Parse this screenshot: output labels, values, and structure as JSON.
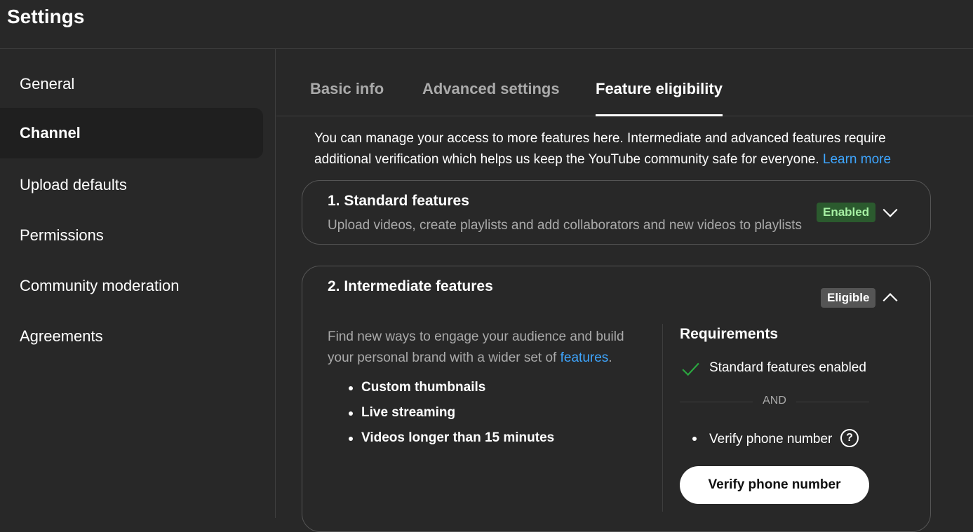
{
  "header": {
    "title": "Settings"
  },
  "sidebar": {
    "items": [
      {
        "label": "General"
      },
      {
        "label": "Channel"
      },
      {
        "label": "Upload defaults"
      },
      {
        "label": "Permissions"
      },
      {
        "label": "Community moderation"
      },
      {
        "label": "Agreements"
      }
    ],
    "active": "Channel"
  },
  "tabs": [
    {
      "label": "Basic info"
    },
    {
      "label": "Advanced settings"
    },
    {
      "label": "Feature eligibility"
    }
  ],
  "active_tab": "Feature eligibility",
  "intro": {
    "text": "You can manage your access to more features here. Intermediate and advanced features require additional verification which helps us keep the YouTube community safe for everyone.",
    "link": "Learn more"
  },
  "standard": {
    "title": "1. Standard features",
    "description": "Upload videos, create playlists and add collaborators and new videos to playlists",
    "badge": "Enabled"
  },
  "intermediate": {
    "title": "2. Intermediate features",
    "badge": "Eligible",
    "description_prefix": "Find new ways to engage your audience and build your personal brand with a wider set of",
    "description_link": "features",
    "description_suffix": ".",
    "features": [
      "Custom thumbnails",
      "Live streaming",
      "Videos longer than 15 minutes"
    ],
    "requirements": {
      "title": "Requirements",
      "met": "Standard features enabled",
      "separator": "AND",
      "pending": "Verify phone number",
      "help_glyph": "?",
      "button": "Verify phone number"
    }
  },
  "colors": {
    "background": "#282828",
    "link": "#3ea6ff",
    "enabled_badge_bg": "#2b5a2e",
    "enabled_badge_text": "#a6f0a3",
    "check": "#2ba640"
  }
}
